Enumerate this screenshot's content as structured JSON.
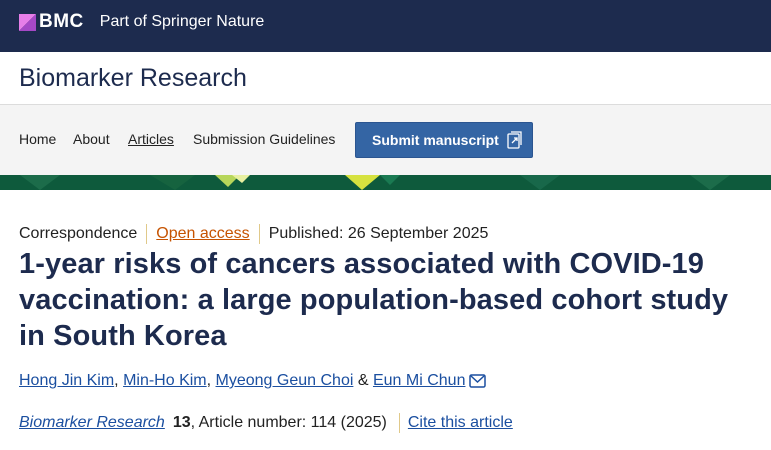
{
  "header": {
    "brand": "BMC",
    "subtitle": "Part of Springer Nature",
    "brand_color": "#1d2b4e",
    "logo_color": "#c24fd6"
  },
  "journal": {
    "title": "Biomarker Research"
  },
  "nav": {
    "items": [
      {
        "label": "Home"
      },
      {
        "label": "About"
      },
      {
        "label": "Articles"
      },
      {
        "label": "Submission Guidelines"
      }
    ],
    "submit_label": "Submit manuscript",
    "submit_icon": "external-submit-icon",
    "button_color": "#3465a4"
  },
  "article": {
    "type": "Correspondence",
    "open_access": "Open access",
    "published": "Published: 26 September 2025",
    "title": "1-year risks of cancers associated with COVID-19 vaccination: a large population-based cohort study in South Korea",
    "authors": [
      {
        "name": "Hong Jin Kim"
      },
      {
        "name": "Min-Ho Kim"
      },
      {
        "name": "Myeong Geun Choi"
      },
      {
        "name": "Eun Mi Chun"
      }
    ],
    "author_separator_comma": ",",
    "author_separator_and": "&",
    "mail_icon": "mail-icon",
    "citation": {
      "journal": "Biomarker Research",
      "volume": "13",
      "article_info": ", Article number: 114 (2025)",
      "cite_link": "Cite this article"
    },
    "link_color": "#1b4fa0",
    "open_access_color": "#c65301"
  }
}
